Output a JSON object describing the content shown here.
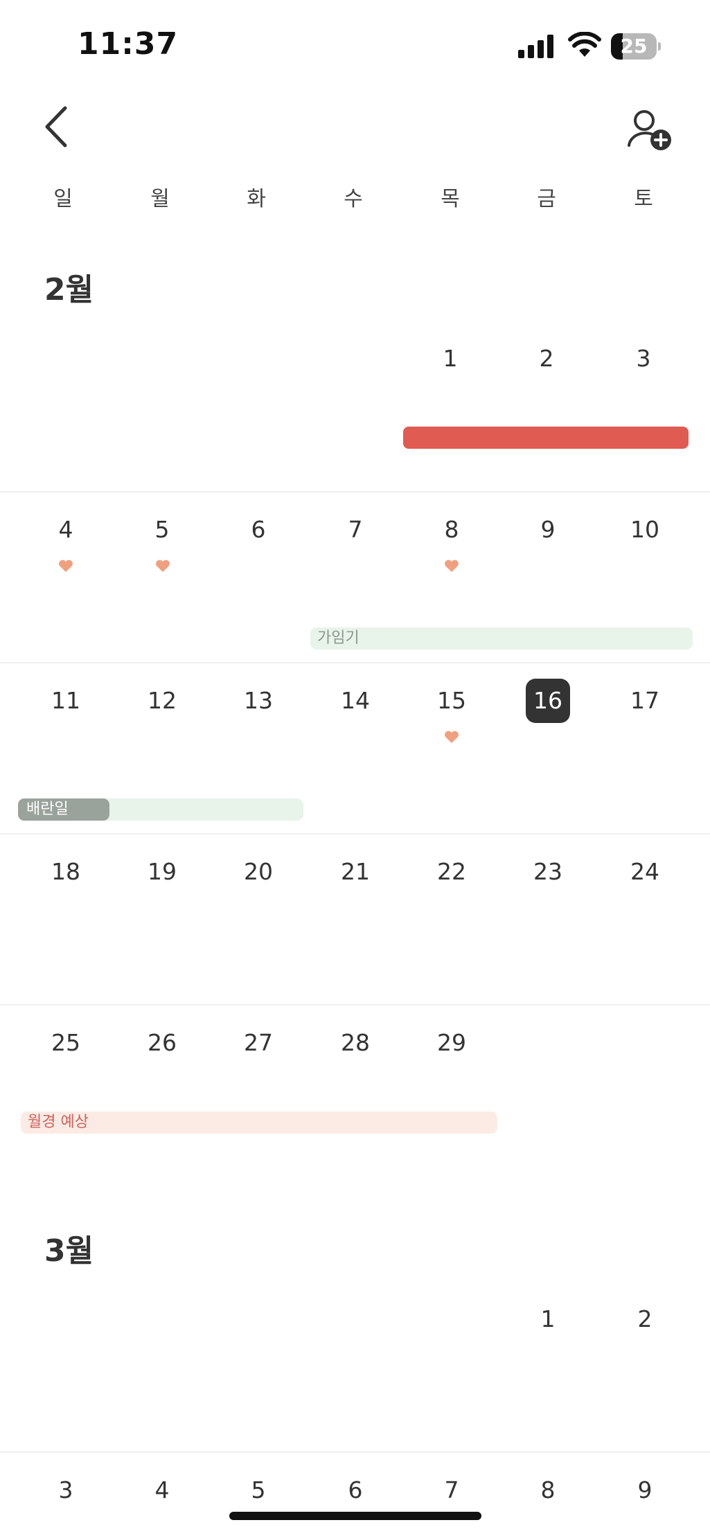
{
  "status_bar": {
    "time": "11:37",
    "battery_level": "25"
  },
  "header": {
    "back_icon": "chevron-left-icon",
    "add_user_icon": "person-add-icon"
  },
  "weekdays": [
    "일",
    "월",
    "화",
    "수",
    "목",
    "금",
    "토"
  ],
  "colors": {
    "period": "#e05b52",
    "fertile": "#e8f4ea",
    "ovulation": "#99a29b",
    "expected": "#fcebe4",
    "heart": "#f0a07f",
    "today": "#333333"
  },
  "months": [
    {
      "title": "2월",
      "weeks": [
        [
          "",
          "",
          "",
          "",
          "1",
          "2",
          "3"
        ],
        [
          "4",
          "5",
          "6",
          "7",
          "8",
          "9",
          "10"
        ],
        [
          "11",
          "12",
          "13",
          "14",
          "15",
          "16",
          "17"
        ],
        [
          "18",
          "19",
          "20",
          "21",
          "22",
          "23",
          "24"
        ],
        [
          "25",
          "26",
          "27",
          "28",
          "29",
          "",
          ""
        ]
      ],
      "today": "16",
      "heart_days": [
        "4",
        "5",
        "8",
        "15"
      ],
      "bars": {
        "fertile_label": "가임기",
        "ovulation_label": "배란일",
        "expected_label": "월경 예상"
      }
    },
    {
      "title": "3월",
      "weeks": [
        [
          "",
          "",
          "",
          "",
          "",
          "1",
          "2"
        ],
        [
          "3",
          "4",
          "5",
          "6",
          "7",
          "8",
          "9"
        ]
      ]
    }
  ]
}
